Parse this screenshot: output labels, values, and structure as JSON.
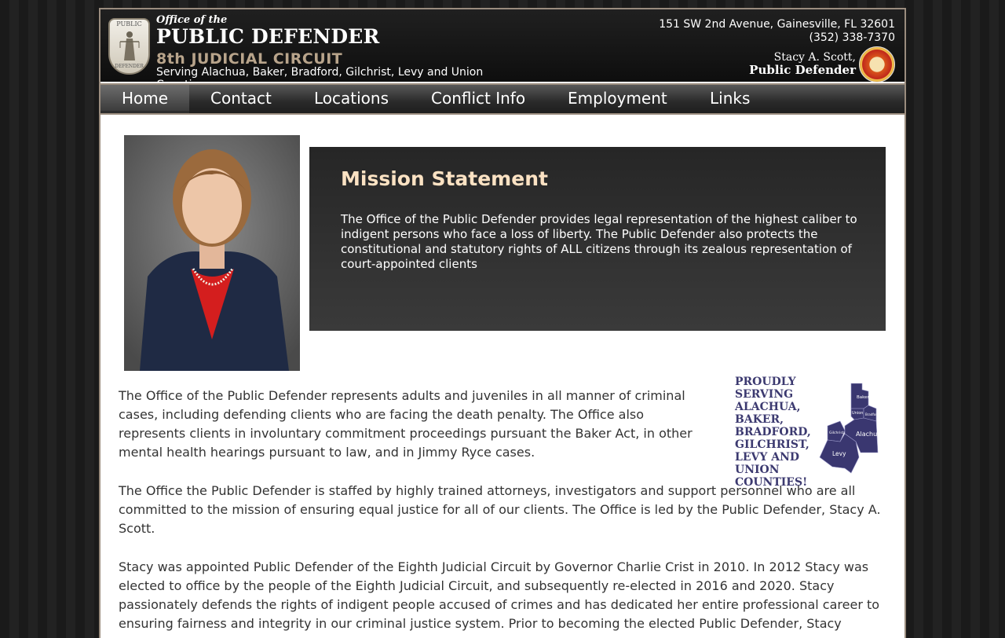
{
  "header": {
    "seal_text_top": "PUBLIC",
    "seal_text_bottom": "DEFENDER",
    "office_of": "Office of the",
    "title": "PUBLIC DEFENDER",
    "circuit": "8th JUDICIAL CIRCUIT",
    "serving": "Serving Alachua, Baker, Bradford, Gilchrist, Levy and Union Counties",
    "address": "151 SW 2nd Avenue, Gainesville, FL 32601",
    "phone": "(352) 338-7370",
    "pd_name": "Stacy A. Scott,",
    "pd_title": "Public Defender"
  },
  "nav": {
    "items": [
      "Home",
      "Contact",
      "Locations",
      "Conflict Info",
      "Employment",
      "Links"
    ],
    "active": "Home"
  },
  "mission": {
    "heading": "Mission Statement",
    "text": "The Office of the Public Defender provides legal representation of the highest caliber to indigent persons who face a loss of liberty. The Public Defender also protects the constitutional and statutory rights of ALL citizens through its zealous representation of court-appointed clients"
  },
  "counties_banner": "PROUDLY SERVING ALACHUA, BAKER, BRADFORD, GILCHRIST, LEVY AND UNION COUNTIES!",
  "map_labels": {
    "baker": "Baker",
    "union": "Union",
    "bradford": "Bradford",
    "gilchrist": "Gilchrist",
    "alachua": "Alachua",
    "levy": "Levy"
  },
  "body": {
    "p1": "The Office of the Public Defender represents adults and juveniles in all manner of criminal cases, including defending clients who are facing the death penalty. The Office also represents clients in involuntary commitment proceedings pursuant the Baker Act, in other mental health hearings pursuant to law, and in Jimmy Ryce cases.",
    "p2": "The Office the Public Defender is staffed by highly trained attorneys, investigators and support personnel who are all committed to the mission of ensuring equal justice for all of our clients. The Office is led by the Public Defender, Stacy A. Scott.",
    "p3": "Stacy was appointed Public Defender of the Eighth Judicial Circuit by Governor Charlie Crist in 2010. In 2012 Stacy was elected to office by the people of the Eighth Judicial Circuit, and subsequently re-elected in 2016 and 2020. Stacy passionately defends the rights of indigent people accused of crimes and has dedicated her entire professional career to ensuring fairness and integrity in our criminal justice system. Prior to becoming the elected Public Defender, Stacy"
  },
  "colors": {
    "header_bg": "#111111",
    "circuit_text": "#b8a48b",
    "mission_heading": "#fbe2c3",
    "counties_text": "#3c3a70",
    "frame_border": "#9a8c7e"
  }
}
